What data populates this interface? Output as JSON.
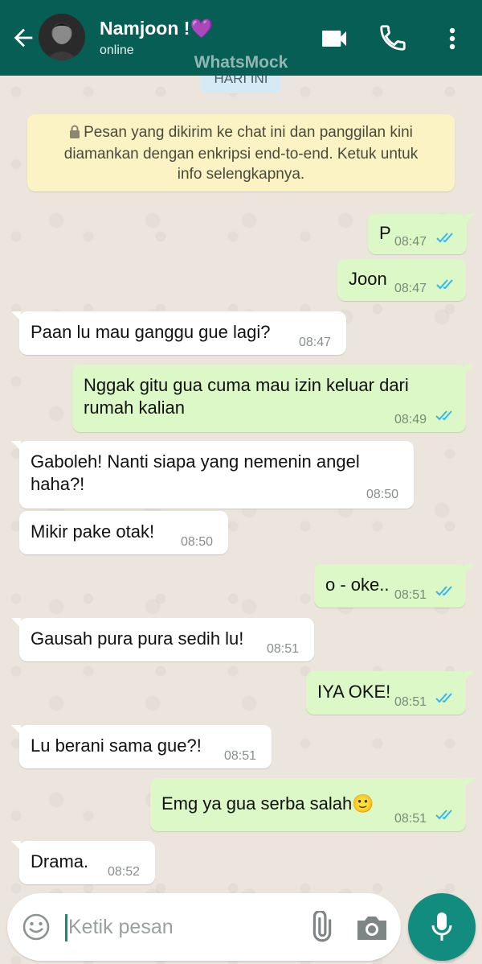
{
  "header": {
    "contact_name": "Namjoon !💜",
    "status": "online",
    "watermark": "WhatsMock"
  },
  "date_separator": "HARI INI",
  "encryption_notice": {
    "line1": "Pesan yang dikirim ke chat ini dan panggilan kini",
    "line2": "diamankan dengan enkripsi end-to-end. Ketuk untuk",
    "line3": "info selengkapnya."
  },
  "messages": [
    {
      "direction": "out",
      "text": "P",
      "time": "08:47",
      "status": "read"
    },
    {
      "direction": "out",
      "text": "Joon",
      "time": "08:47",
      "status": "read"
    },
    {
      "direction": "in",
      "text": "Paan lu mau ganggu gue lagi?",
      "time": "08:47"
    },
    {
      "direction": "out",
      "text": "Nggak gitu gua cuma mau izin keluar dari",
      "text2": "rumah kalian",
      "time": "08:49",
      "status": "read"
    },
    {
      "direction": "in",
      "text": "Gaboleh! Nanti siapa yang nemenin angel",
      "text2": "haha?!",
      "time": "08:50"
    },
    {
      "direction": "in",
      "text": "Mikir pake otak!",
      "time": "08:50"
    },
    {
      "direction": "out",
      "text": "o - oke..",
      "time": "08:51",
      "status": "read"
    },
    {
      "direction": "in",
      "text": "Gausah pura pura sedih lu!",
      "time": "08:51"
    },
    {
      "direction": "out",
      "text": "IYA OKE!",
      "time": "08:51",
      "status": "read"
    },
    {
      "direction": "in",
      "text": "Lu berani sama gue?!",
      "time": "08:51"
    },
    {
      "direction": "out",
      "text": "Emg ya gua serba salah🙂",
      "time": "08:51",
      "status": "read"
    },
    {
      "direction": "in",
      "text": "Drama.",
      "time": "08:52"
    }
  ],
  "composer": {
    "placeholder": "Ketik pesan"
  },
  "colors": {
    "header": "#075e54",
    "outgoing_bubble": "#dcf8c6",
    "incoming_bubble": "#ffffff",
    "read_ticks": "#34b7f1",
    "mic_button": "#128c7e",
    "notice_bg": "#fcf3c4"
  }
}
